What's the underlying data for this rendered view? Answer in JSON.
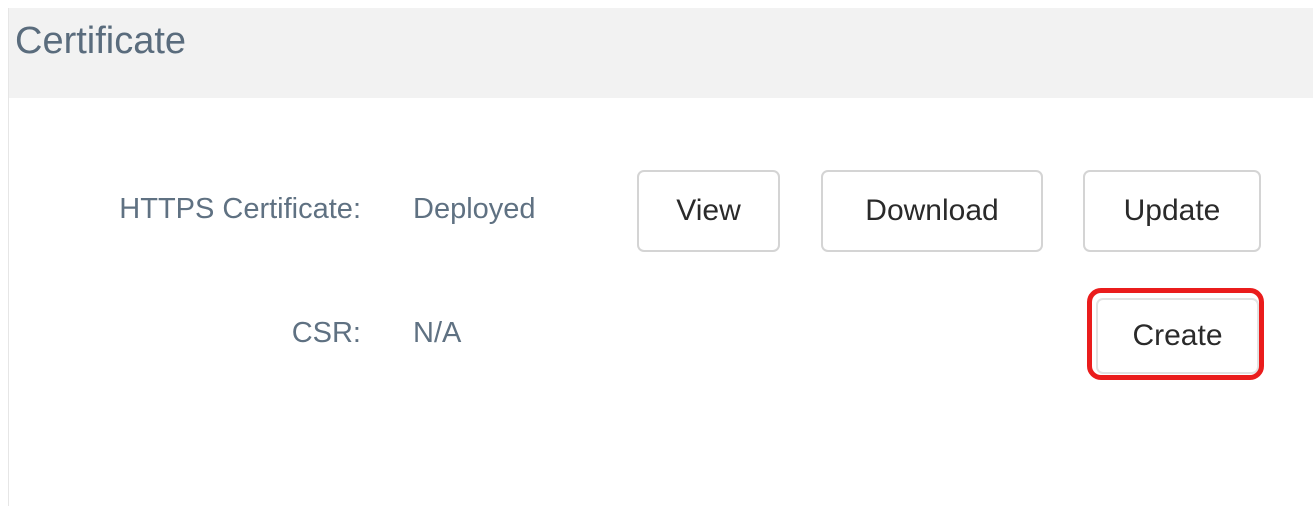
{
  "panel": {
    "title": "Certificate"
  },
  "rows": {
    "https": {
      "label": "HTTPS Certificate:",
      "value": "Deployed",
      "buttons": {
        "view": "View",
        "download": "Download",
        "update": "Update"
      }
    },
    "csr": {
      "label": "CSR:",
      "value": "N/A",
      "buttons": {
        "create": "Create"
      }
    }
  },
  "colors": {
    "highlight": "#ea1c1c",
    "label": "#5f7182",
    "title": "#5a6c7d",
    "header_bg": "#f2f2f2"
  }
}
